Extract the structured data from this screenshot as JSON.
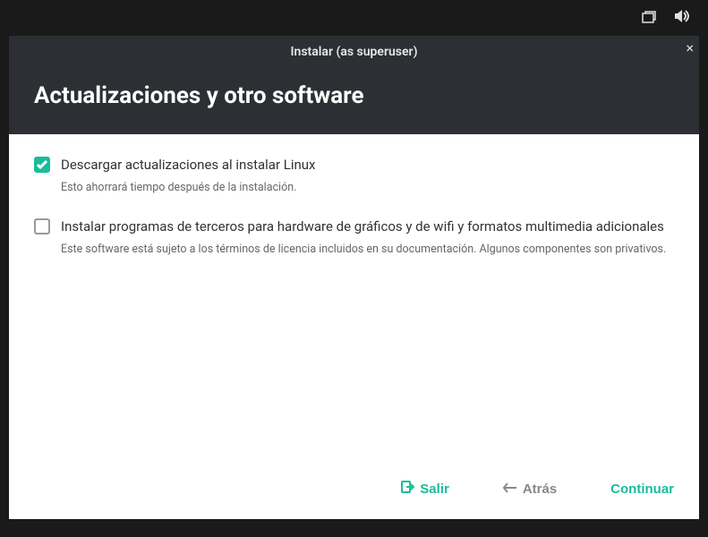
{
  "topbar": {
    "window_icon": "window-restore-icon",
    "volume_icon": "volume-icon"
  },
  "window": {
    "title": "Instalar (as superuser)",
    "close_label": "×"
  },
  "page": {
    "heading": "Actualizaciones y otro software"
  },
  "options": [
    {
      "checked": true,
      "label": "Descargar actualizaciones al instalar Linux",
      "description": "Esto ahorrará tiempo después de la instalación."
    },
    {
      "checked": false,
      "label": "Instalar programas de terceros para hardware de gráficos y de wifi y formatos multimedia adicionales",
      "description": "Este software está sujeto a los términos de licencia incluidos en su documentación. Algunos componentes son privativos."
    }
  ],
  "footer": {
    "quit": "Salir",
    "back": "Atrás",
    "continue": "Continuar"
  }
}
